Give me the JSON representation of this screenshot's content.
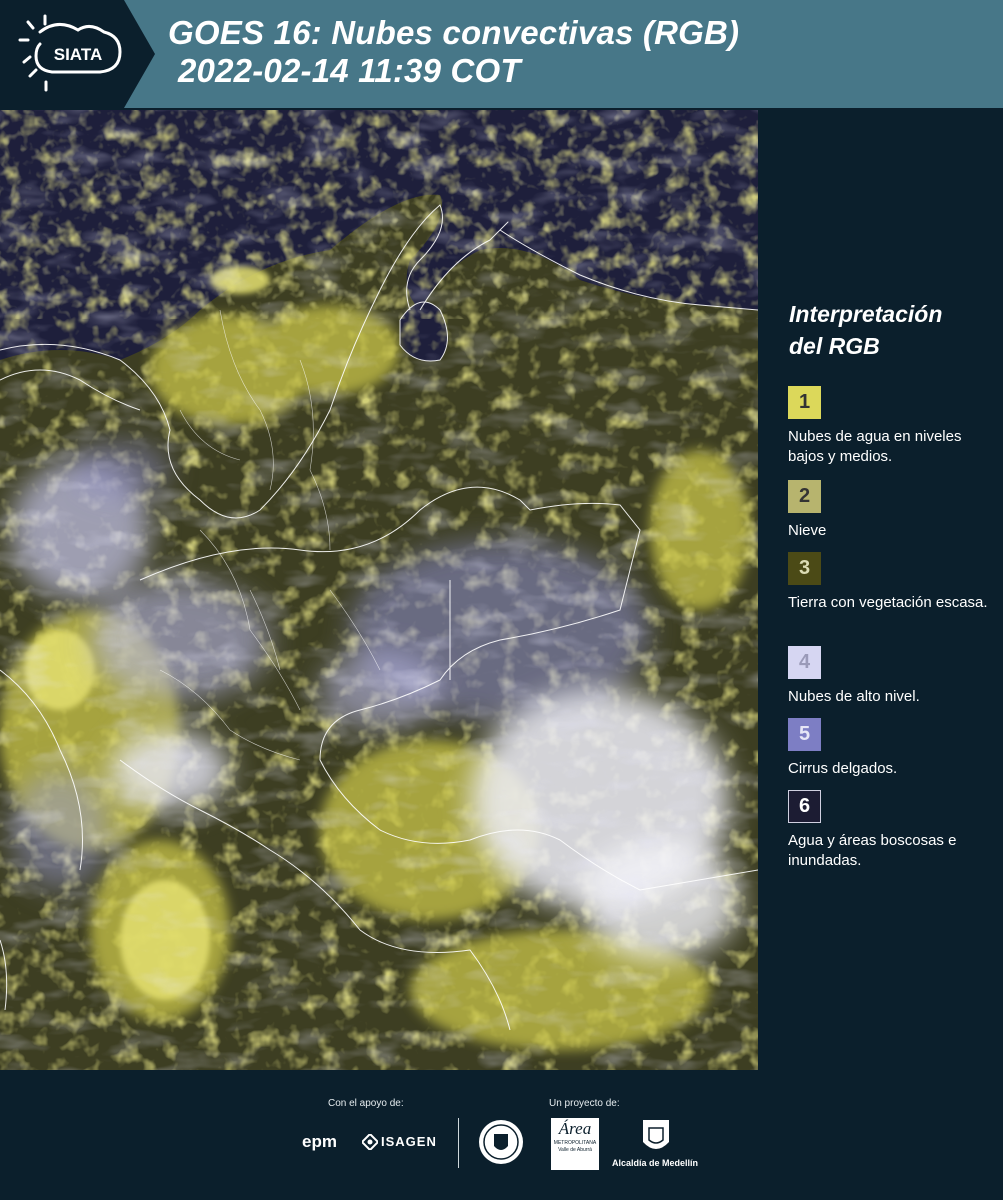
{
  "header": {
    "logo_text": "SIATA",
    "title_line1": "GOES 16: Nubes convectivas (RGB)",
    "title_line2": "2022-02-14 11:39 COT"
  },
  "legend": {
    "title_line1": "Interpretación",
    "title_line2": "del RGB",
    "items": [
      {
        "num": "1",
        "label": "Nubes de agua en niveles bajos y medios.",
        "color": "#dcd85a"
      },
      {
        "num": "2",
        "label": "Nieve",
        "color": "#b7b46e"
      },
      {
        "num": "3",
        "label": "Tierra con vegetación escasa.",
        "color": "#4b4a16"
      },
      {
        "num": "4",
        "label": "Nubes de alto nivel.",
        "color": "#d6d6f2"
      },
      {
        "num": "5",
        "label": "Cirrus delgados.",
        "color": "#7d7ec4"
      },
      {
        "num": "6",
        "label": "Agua y áreas boscosas e inundadas.",
        "color": "#1c1c33"
      }
    ]
  },
  "footer": {
    "support_label": "Con el apoyo de:",
    "project_label": "Un proyecto de:",
    "epm": "epm",
    "isagen": "ISAGEN",
    "area_name": "Área",
    "area_sub1": "METROPOLITANA",
    "area_sub2": "Valle de Aburrá",
    "alcaldia": "Alcaldía de Medellín"
  }
}
